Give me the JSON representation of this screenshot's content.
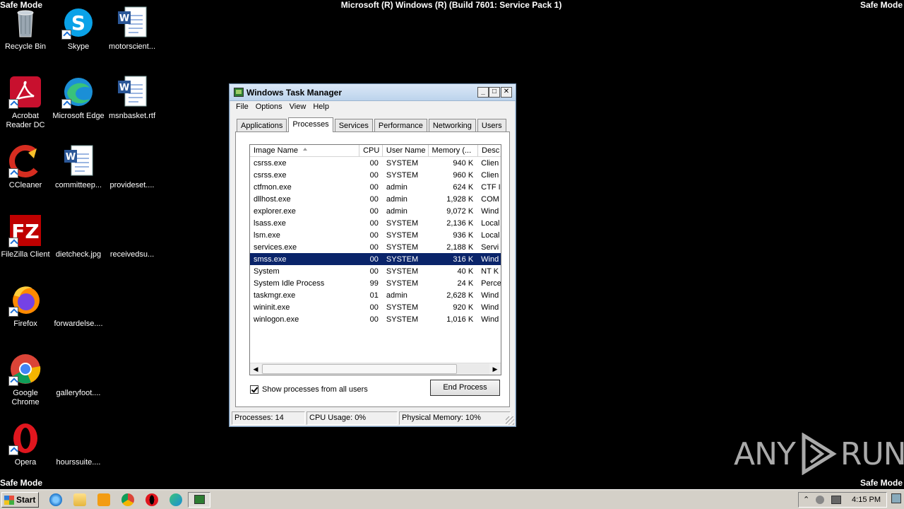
{
  "safe_mode": {
    "tl": "Safe Mode",
    "tr": "Safe Mode",
    "bl": "Safe Mode",
    "br": "Safe Mode"
  },
  "build_text": "Microsoft (R) Windows (R) (Build 7601: Service Pack 1)",
  "desktop_icons": [
    {
      "label": "Recycle Bin",
      "icon": "recycle-bin-icon"
    },
    {
      "label": "Skype",
      "icon": "skype-icon"
    },
    {
      "label": "motorscient...",
      "icon": "word-document-icon"
    },
    {
      "label": "Acrobat Reader DC",
      "icon": "acrobat-icon"
    },
    {
      "label": "Microsoft Edge",
      "icon": "edge-icon"
    },
    {
      "label": "msnbasket.rtf",
      "icon": "word-document-icon"
    },
    {
      "label": "CCleaner",
      "icon": "ccleaner-icon"
    },
    {
      "label": "committeep...",
      "icon": "word-document-icon"
    },
    {
      "label": "provideset....",
      "icon": "blank-file-icon"
    },
    {
      "label": "FileZilla Client",
      "icon": "filezilla-icon"
    },
    {
      "label": "dietcheck.jpg",
      "icon": "blank-file-icon"
    },
    {
      "label": "receivedsu...",
      "icon": "blank-file-icon"
    },
    {
      "label": "Firefox",
      "icon": "firefox-icon"
    },
    {
      "label": "forwardelse....",
      "icon": "blank-file-icon"
    },
    {
      "label": "Google Chrome",
      "icon": "chrome-icon"
    },
    {
      "label": "galleryfoot....",
      "icon": "blank-file-icon"
    },
    {
      "label": "Opera",
      "icon": "opera-icon"
    },
    {
      "label": "hourssuite....",
      "icon": "blank-file-icon"
    }
  ],
  "task_manager": {
    "title": "Windows Task Manager",
    "menu": [
      "File",
      "Options",
      "View",
      "Help"
    ],
    "tabs": [
      "Applications",
      "Processes",
      "Services",
      "Performance",
      "Networking",
      "Users"
    ],
    "active_tab": "Processes",
    "columns": [
      "Image Name",
      "CPU",
      "User Name",
      "Memory (...",
      "Desc"
    ],
    "rows": [
      {
        "name": "csrss.exe",
        "cpu": "00",
        "user": "SYSTEM",
        "mem": "940 K",
        "desc": "Clien"
      },
      {
        "name": "csrss.exe",
        "cpu": "00",
        "user": "SYSTEM",
        "mem": "960 K",
        "desc": "Clien"
      },
      {
        "name": "ctfmon.exe",
        "cpu": "00",
        "user": "admin",
        "mem": "624 K",
        "desc": "CTF I"
      },
      {
        "name": "dllhost.exe",
        "cpu": "00",
        "user": "admin",
        "mem": "1,928 K",
        "desc": "COM"
      },
      {
        "name": "explorer.exe",
        "cpu": "00",
        "user": "admin",
        "mem": "9,072 K",
        "desc": "Wind"
      },
      {
        "name": "lsass.exe",
        "cpu": "00",
        "user": "SYSTEM",
        "mem": "2,136 K",
        "desc": "Local"
      },
      {
        "name": "lsm.exe",
        "cpu": "00",
        "user": "SYSTEM",
        "mem": "936 K",
        "desc": "Local"
      },
      {
        "name": "services.exe",
        "cpu": "00",
        "user": "SYSTEM",
        "mem": "2,188 K",
        "desc": "Servi"
      },
      {
        "name": "smss.exe",
        "cpu": "00",
        "user": "SYSTEM",
        "mem": "316 K",
        "desc": "Wind",
        "selected": true
      },
      {
        "name": "System",
        "cpu": "00",
        "user": "SYSTEM",
        "mem": "40 K",
        "desc": "NT K"
      },
      {
        "name": "System Idle Process",
        "cpu": "99",
        "user": "SYSTEM",
        "mem": "24 K",
        "desc": "Perce"
      },
      {
        "name": "taskmgr.exe",
        "cpu": "01",
        "user": "admin",
        "mem": "2,628 K",
        "desc": "Wind"
      },
      {
        "name": "wininit.exe",
        "cpu": "00",
        "user": "SYSTEM",
        "mem": "920 K",
        "desc": "Wind"
      },
      {
        "name": "winlogon.exe",
        "cpu": "00",
        "user": "SYSTEM",
        "mem": "1,016 K",
        "desc": "Wind"
      }
    ],
    "show_all_label": "Show processes from all users",
    "show_all_checked": true,
    "end_process_label": "End Process",
    "status": {
      "processes": "Processes: 14",
      "cpu": "CPU Usage: 0%",
      "memory": "Physical Memory: 10%"
    }
  },
  "taskbar": {
    "start_label": "Start",
    "pinned": [
      "ie-icon",
      "explorer-folder-icon",
      "media-player-icon",
      "chrome-icon",
      "opera-icon",
      "edge-icon",
      "task-manager-icon"
    ],
    "clock": "4:15 PM"
  },
  "watermark": {
    "left": "ANY",
    "right": "RUN"
  }
}
